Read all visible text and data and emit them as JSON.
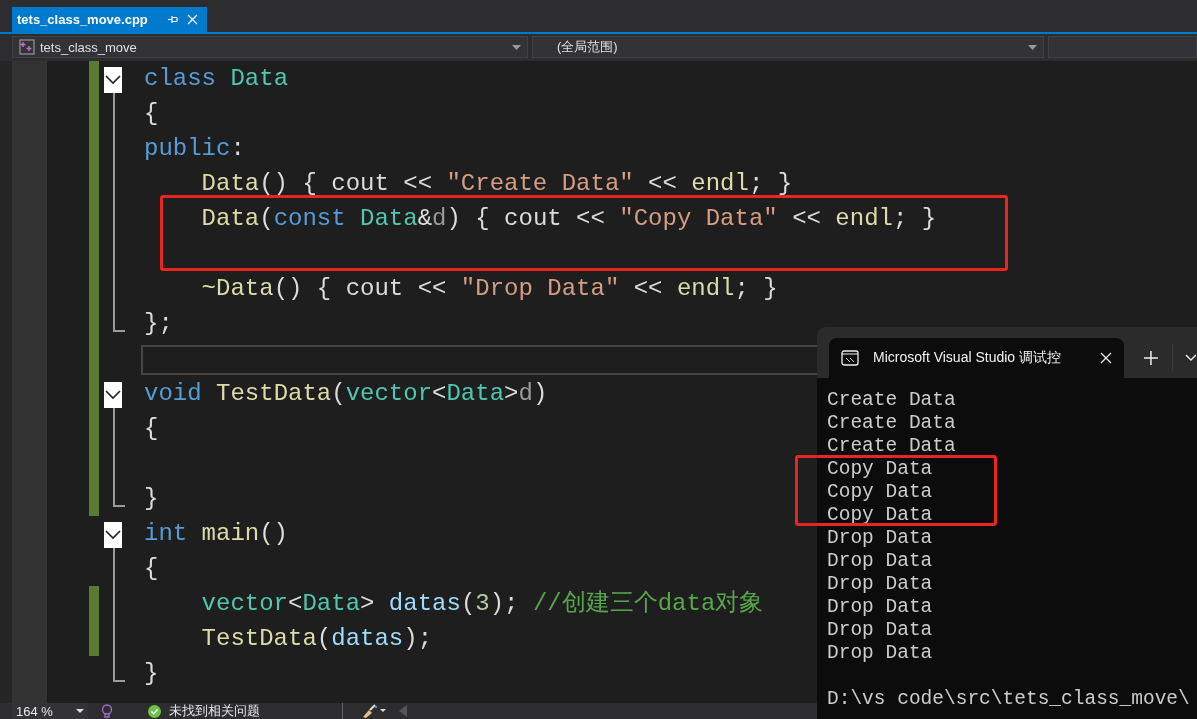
{
  "tab": {
    "title": "tets_class_move.cpp",
    "selected": true
  },
  "nav": {
    "project": "tets_class_move",
    "scope": "(全局范围)"
  },
  "code_lines": [
    {
      "kind": "line",
      "changed": true,
      "collapsible": true,
      "block_end": false,
      "tokens": [
        {
          "kind": "keyword",
          "text": "class "
        },
        {
          "kind": "type",
          "text": "Data"
        }
      ]
    },
    {
      "kind": "line",
      "changed": true,
      "collapsible": false,
      "block_end": false,
      "tokens": [
        {
          "kind": "plain",
          "text": "{"
        }
      ]
    },
    {
      "kind": "line",
      "changed": true,
      "collapsible": false,
      "block_end": false,
      "tokens": [
        {
          "kind": "keyword",
          "text": "public"
        },
        {
          "kind": "plain",
          "text": ":"
        }
      ]
    },
    {
      "kind": "line",
      "changed": true,
      "collapsible": false,
      "block_end": false,
      "tokens": [
        {
          "kind": "function",
          "text": "    Data"
        },
        {
          "kind": "plain",
          "text": "() { cout << "
        },
        {
          "kind": "string",
          "text": "\"Create Data\""
        },
        {
          "kind": "plain",
          "text": " << "
        },
        {
          "kind": "function",
          "text": "endl"
        },
        {
          "kind": "plain",
          "text": "; }"
        }
      ]
    },
    {
      "kind": "boxed_group",
      "lines": [
        {
          "kind": "line",
          "changed": true,
          "collapsible": false,
          "block_end": false,
          "tokens": [
            {
              "kind": "function",
              "text": "    Data"
            },
            {
              "kind": "plain",
              "text": "("
            },
            {
              "kind": "keyword",
              "text": "const "
            },
            {
              "kind": "type",
              "text": "Data"
            },
            {
              "kind": "plain",
              "text": "&"
            },
            {
              "kind": "param",
              "text": "d"
            },
            {
              "kind": "plain",
              "text": ") { cout << "
            },
            {
              "kind": "string",
              "text": "\"Copy Data\""
            },
            {
              "kind": "plain",
              "text": " << "
            },
            {
              "kind": "function",
              "text": "endl"
            },
            {
              "kind": "plain",
              "text": "; }"
            }
          ]
        },
        {
          "kind": "line",
          "changed": true,
          "collapsible": false,
          "block_end": false
        }
      ]
    },
    {
      "kind": "line",
      "changed": true,
      "collapsible": false,
      "block_end": false,
      "tokens": [
        {
          "kind": "function",
          "text": "    ~Data"
        },
        {
          "kind": "plain",
          "text": "() { cout << "
        },
        {
          "kind": "string",
          "text": "\"Drop Data\""
        },
        {
          "kind": "plain",
          "text": " << "
        },
        {
          "kind": "function",
          "text": "endl"
        },
        {
          "kind": "plain",
          "text": "; }"
        }
      ]
    },
    {
      "kind": "line",
      "changed": true,
      "collapsible": false,
      "block_end": true,
      "tokens": [
        {
          "kind": "plain",
          "text": "};"
        }
      ]
    },
    {
      "kind": "current_line",
      "changed": true
    },
    {
      "kind": "line",
      "changed": true,
      "collapsible": true,
      "block_end": false,
      "tokens": [
        {
          "kind": "keyword",
          "text": "void "
        },
        {
          "kind": "function",
          "text": "TestData"
        },
        {
          "kind": "plain",
          "text": "("
        },
        {
          "kind": "type",
          "text": "vector"
        },
        {
          "kind": "plain",
          "text": "<"
        },
        {
          "kind": "type",
          "text": "Data"
        },
        {
          "kind": "plain",
          "text": ">"
        },
        {
          "kind": "param",
          "text": "d"
        },
        {
          "kind": "plain",
          "text": ")"
        }
      ]
    },
    {
      "kind": "line",
      "changed": true,
      "collapsible": false,
      "block_end": false,
      "tokens": [
        {
          "kind": "plain",
          "text": "{"
        }
      ]
    },
    {
      "kind": "line",
      "changed": true,
      "collapsible": false,
      "block_end": false
    },
    {
      "kind": "line",
      "changed": true,
      "collapsible": false,
      "block_end": true,
      "tokens": [
        {
          "kind": "plain",
          "text": "}"
        }
      ]
    },
    {
      "kind": "line",
      "changed": false,
      "collapsible": true,
      "block_end": false,
      "tokens": [
        {
          "kind": "keyword",
          "text": "int "
        },
        {
          "kind": "function",
          "text": "main"
        },
        {
          "kind": "plain",
          "text": "()"
        }
      ]
    },
    {
      "kind": "line",
      "changed": false,
      "collapsible": false,
      "block_end": false,
      "tokens": [
        {
          "kind": "plain",
          "text": "{"
        }
      ]
    },
    {
      "kind": "line",
      "changed": true,
      "collapsible": false,
      "block_end": false,
      "tokens": [
        {
          "kind": "type",
          "text": "    vector"
        },
        {
          "kind": "plain",
          "text": "<"
        },
        {
          "kind": "type",
          "text": "Data"
        },
        {
          "kind": "plain",
          "text": "> "
        },
        {
          "kind": "variable",
          "text": "datas"
        },
        {
          "kind": "plain",
          "text": "("
        },
        {
          "kind": "number",
          "text": "3"
        },
        {
          "kind": "plain",
          "text": "); "
        },
        {
          "kind": "comment",
          "text": "//创建三个data对象"
        }
      ]
    },
    {
      "kind": "line",
      "changed": true,
      "collapsible": false,
      "block_end": false,
      "tokens": [
        {
          "kind": "function",
          "text": "    TestData"
        },
        {
          "kind": "plain",
          "text": "("
        },
        {
          "kind": "variable",
          "text": "datas"
        },
        {
          "kind": "plain",
          "text": ");"
        }
      ]
    },
    {
      "kind": "line",
      "changed": false,
      "collapsible": false,
      "block_end": true,
      "tokens": [
        {
          "kind": "plain",
          "text": "}"
        }
      ]
    }
  ],
  "console": {
    "title": "Microsoft Visual Studio 调试控",
    "lines": [
      {
        "kind": "output",
        "text": "Create Data"
      },
      {
        "kind": "output",
        "text": "Create Data"
      },
      {
        "kind": "output",
        "text": "Create Data"
      },
      {
        "kind": "boxed_group",
        "lines": [
          {
            "kind": "output",
            "text": "Copy Data"
          },
          {
            "kind": "output",
            "text": "Copy Data"
          },
          {
            "kind": "output",
            "text": "Copy Data"
          }
        ]
      },
      {
        "kind": "output",
        "text": "Drop Data"
      },
      {
        "kind": "output",
        "text": "Drop Data"
      },
      {
        "kind": "output",
        "text": "Drop Data"
      },
      {
        "kind": "output",
        "text": "Drop Data"
      },
      {
        "kind": "output",
        "text": "Drop Data"
      },
      {
        "kind": "output",
        "text": "Drop Data"
      },
      {
        "kind": "prompt",
        "text": "D:\\vs code\\src\\tets_class_move\\"
      }
    ]
  },
  "status": {
    "zoom": "164 %",
    "issues": "未找到相关问题"
  }
}
